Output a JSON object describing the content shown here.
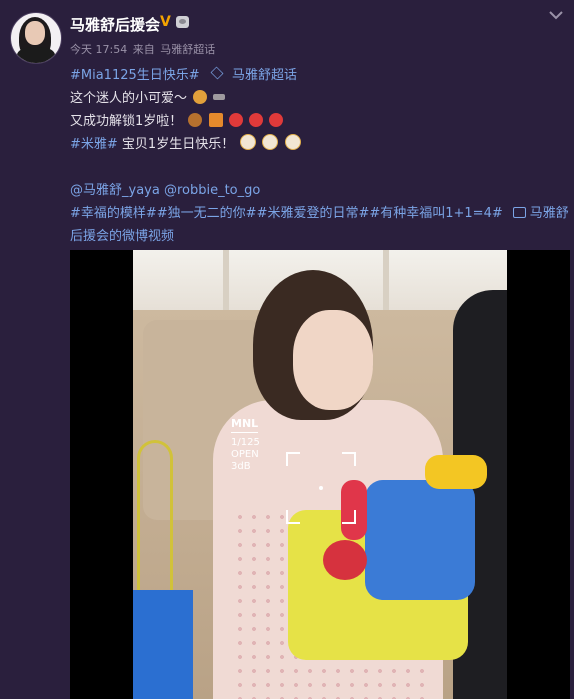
{
  "user": {
    "name": "马雅舒后援会",
    "verified_mark": "V"
  },
  "meta": {
    "time": "今天 17:54",
    "source_prefix": "来自",
    "source": "马雅舒超话"
  },
  "post": {
    "line1_tag": "#Mia1125生日快乐#",
    "line1_link": "马雅舒超话",
    "line2_text": "这个迷人的小可爱～",
    "line3_text": "又成功解锁1岁啦！",
    "line4_tag": "#米雅#",
    "line4_text": " 宝贝1岁生日快乐！",
    "mentions": "@马雅舒_yaya @robbie_to_go",
    "hashtags_line": "#幸福的模样##独一无二的你##米雅爱登的日常##有种幸福叫1+1=4#",
    "video_link_a": "马雅舒",
    "video_link_b": "后援会的微博视频"
  },
  "video": {
    "hud_mode": "MNL",
    "hud_shutter": "1/125",
    "hud_aperture": "OPEN",
    "hud_gain": "3dB"
  },
  "colors": {
    "background": "#2a1f3d",
    "link": "#7ba4e6",
    "verified": "#f4a300"
  },
  "icons": [
    "more-chevron-icon",
    "verified-v-icon",
    "crown-badge-icon",
    "super-topic-icon",
    "video-icon",
    "bear-emoji-icon",
    "key-emoji-icon",
    "donut-emoji-icon",
    "gift-emoji-icon",
    "balloon-emoji-icon",
    "cake-emoji-icon"
  ]
}
